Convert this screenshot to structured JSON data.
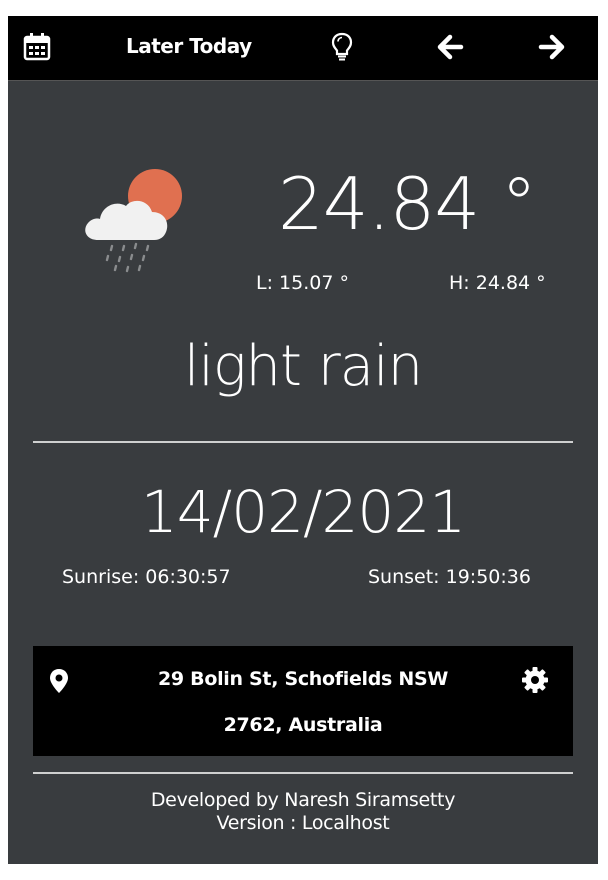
{
  "header": {
    "title": "Later Today",
    "icons": [
      "calendar-icon",
      "lightbulb-icon",
      "arrow-left-icon",
      "arrow-right-icon"
    ]
  },
  "weather": {
    "temperature": "24.84 °",
    "low": "L:  15.07 °",
    "high": "H:  24.84 °",
    "description": "light rain",
    "icon": "cloud-sun-rain-icon"
  },
  "day": {
    "date": "14/02/2021",
    "sunrise": "Sunrise:  06:30:57",
    "sunset": "Sunset:  19:50:36"
  },
  "location": {
    "line1": "29 Bolin St, Schofields NSW",
    "line2": "2762, Australia",
    "icons": [
      "location-pin-icon",
      "gear-icon"
    ]
  },
  "footer": {
    "developer": "Developed by Naresh Siramsetty",
    "version": "Version : Localhost"
  },
  "colors": {
    "background": "#393c3f",
    "bar": "#000000",
    "text": "#ffffff",
    "sun": "#e07050"
  }
}
